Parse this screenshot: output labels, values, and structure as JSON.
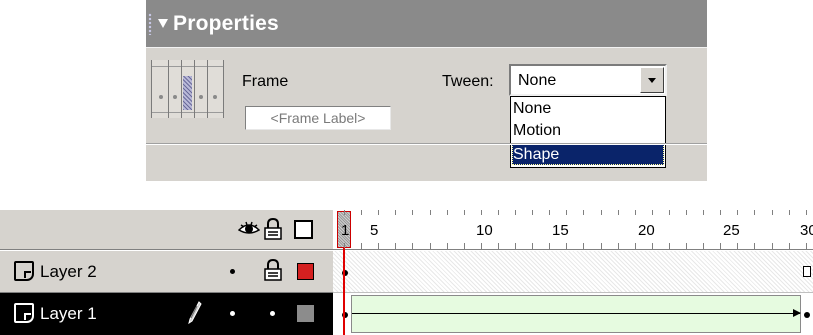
{
  "properties": {
    "title": "Properties",
    "frame_label": "Frame",
    "frame_label_placeholder": "<Frame Label>",
    "tween_label": "Tween:",
    "tween_value": "None",
    "tween_options": [
      "None",
      "Motion",
      "Shape"
    ],
    "tween_highlighted": "Shape",
    "highlight_color": "#0a246a",
    "header_color": "#8a8a8a"
  },
  "timeline": {
    "ruler_labels": [
      "1",
      "5",
      "10",
      "15",
      "20",
      "25",
      "30"
    ],
    "header_icons": [
      "eye-icon",
      "lock-icon",
      "outline-icon"
    ],
    "layers": [
      {
        "name": "Layer 2",
        "locked": true,
        "outline_color": "#d42020",
        "selected": false
      },
      {
        "name": "Layer 1",
        "locked": false,
        "outline_color": "#8c8c8c",
        "selected": true,
        "editing": true
      }
    ],
    "playhead_color": "#e00000",
    "tween_fill": "#e6fbe0"
  }
}
